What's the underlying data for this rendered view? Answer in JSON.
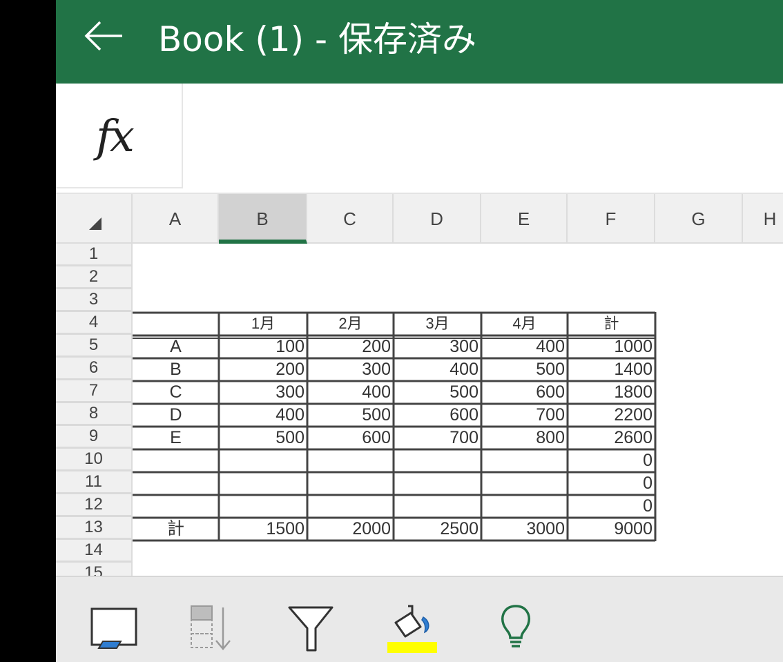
{
  "app": {
    "title": "Book (1) - 保存済み",
    "accent": "#217346",
    "highlight": "#ffff00"
  },
  "formula_bar": {
    "fx_label": "fx",
    "value": ""
  },
  "columns": [
    "A",
    "B",
    "C",
    "D",
    "E",
    "F",
    "G",
    "H"
  ],
  "selected_column": "B",
  "rows": [
    "1",
    "2",
    "3",
    "4",
    "5",
    "6",
    "7",
    "8",
    "9",
    "10",
    "11",
    "12",
    "13",
    "14",
    "15"
  ],
  "table": {
    "header": [
      "",
      "1月",
      "2月",
      "3月",
      "4月",
      "計"
    ],
    "body": [
      [
        "A",
        "100",
        "200",
        "300",
        "400",
        "1000"
      ],
      [
        "B",
        "200",
        "300",
        "400",
        "500",
        "1400"
      ],
      [
        "C",
        "300",
        "400",
        "500",
        "600",
        "1800"
      ],
      [
        "D",
        "400",
        "500",
        "600",
        "700",
        "2200"
      ],
      [
        "E",
        "500",
        "600",
        "700",
        "800",
        "2600"
      ],
      [
        "",
        "",
        "",
        "",
        "",
        "0"
      ],
      [
        "",
        "",
        "",
        "",
        "",
        "0"
      ],
      [
        "",
        "",
        "",
        "",
        "",
        "0"
      ],
      [
        "計",
        "1500",
        "2000",
        "2500",
        "3000",
        "9000"
      ]
    ]
  },
  "toolbar": {
    "icons": [
      "select-cell-icon",
      "sort-icon",
      "filter-icon",
      "fill-color-icon",
      "ideas-lightbulb-icon"
    ]
  }
}
